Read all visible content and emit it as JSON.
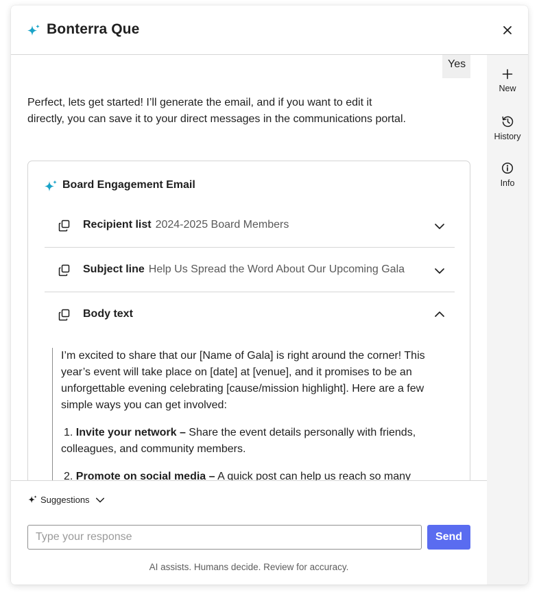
{
  "header": {
    "title": "Bonterra Que",
    "icon": "sparkle-icon",
    "close_icon": "close-icon"
  },
  "rail": [
    {
      "label": "New",
      "icon": "plus-icon"
    },
    {
      "label": "History",
      "icon": "history-icon"
    },
    {
      "label": "Info",
      "icon": "info-icon"
    }
  ],
  "chat": {
    "user_message": "Yes",
    "ai_message": "Perfect, lets get started! I’ll generate the email, and if you want to edit it directly, you can save it to your direct messages in the communications portal.",
    "card": {
      "title": "Board Engagement Email",
      "rows": [
        {
          "label": "Recipient list",
          "value": "2024-2025 Board Members",
          "expanded": false
        },
        {
          "label": "Subject line",
          "value": "Help Us Spread the Word About Our Upcoming Gala",
          "expanded": false
        },
        {
          "label": "Body text",
          "value": "",
          "expanded": true
        }
      ],
      "body": {
        "intro": "I’m excited to share that our [Name of Gala] is right around the corner! This year’s event will take place on [date] at [venue], and it promises to be an unforgettable evening celebrating [cause/mission highlight]. Here are a few simple ways you can get involved:",
        "items": [
          {
            "num": "1.",
            "bold": "Invite your network –",
            "text": " Share the event details personally with friends, colleagues, and community members."
          },
          {
            "num": "2.",
            "bold": "Promote on social media –",
            "text": " A quick post can help us reach so many"
          }
        ]
      }
    }
  },
  "footer": {
    "suggestions_label": "Suggestions",
    "input_placeholder": "Type your response",
    "send_label": "Send",
    "disclaimer": "AI assists. Humans decide. Review for accuracy."
  },
  "colors": {
    "accent": "#5a6cf0",
    "sparkle": "#1aa3c8",
    "rail_bg": "#f4f4f4"
  }
}
